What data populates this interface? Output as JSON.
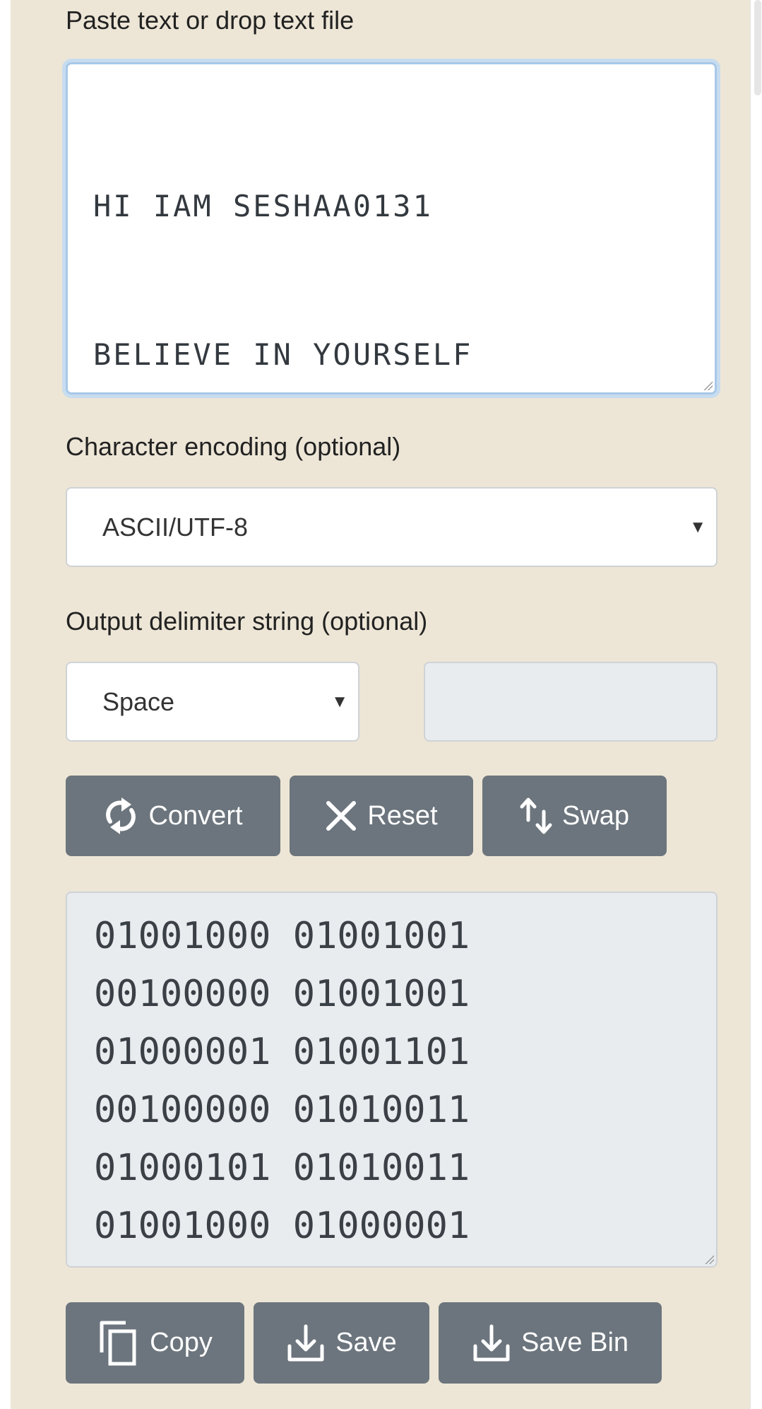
{
  "input": {
    "label": "Paste text or drop text file",
    "lines": [
      "HI IAM SESHAA0131",
      "BELIEVE IN YOURSELF"
    ]
  },
  "encoding": {
    "label": "Character encoding (optional)",
    "selected": "ASCII/UTF-8"
  },
  "delimiter": {
    "label": "Output delimiter string (optional)",
    "selected": "Space",
    "custom_value": ""
  },
  "actions": {
    "convert": "Convert",
    "reset": "Reset",
    "swap": "Swap"
  },
  "output": {
    "lines": [
      "01001000 01001001",
      "00100000 01001001",
      "01000001 01001101",
      "00100000 01010011",
      "01000101 01010011",
      "01001000 01000001"
    ]
  },
  "output_actions": {
    "copy": "Copy",
    "save": "Save",
    "save_bin": "Save Bin"
  },
  "colors": {
    "panel_bg": "#ede6d6",
    "button_bg": "#6c757d",
    "focus_border": "#a8c8e8",
    "readonly_bg": "#e9ecef"
  },
  "icons": {
    "convert": "refresh-icon",
    "reset": "close-icon",
    "swap": "swap-arrows-icon",
    "copy": "copy-icon",
    "save": "download-icon",
    "save_bin": "download-icon"
  }
}
